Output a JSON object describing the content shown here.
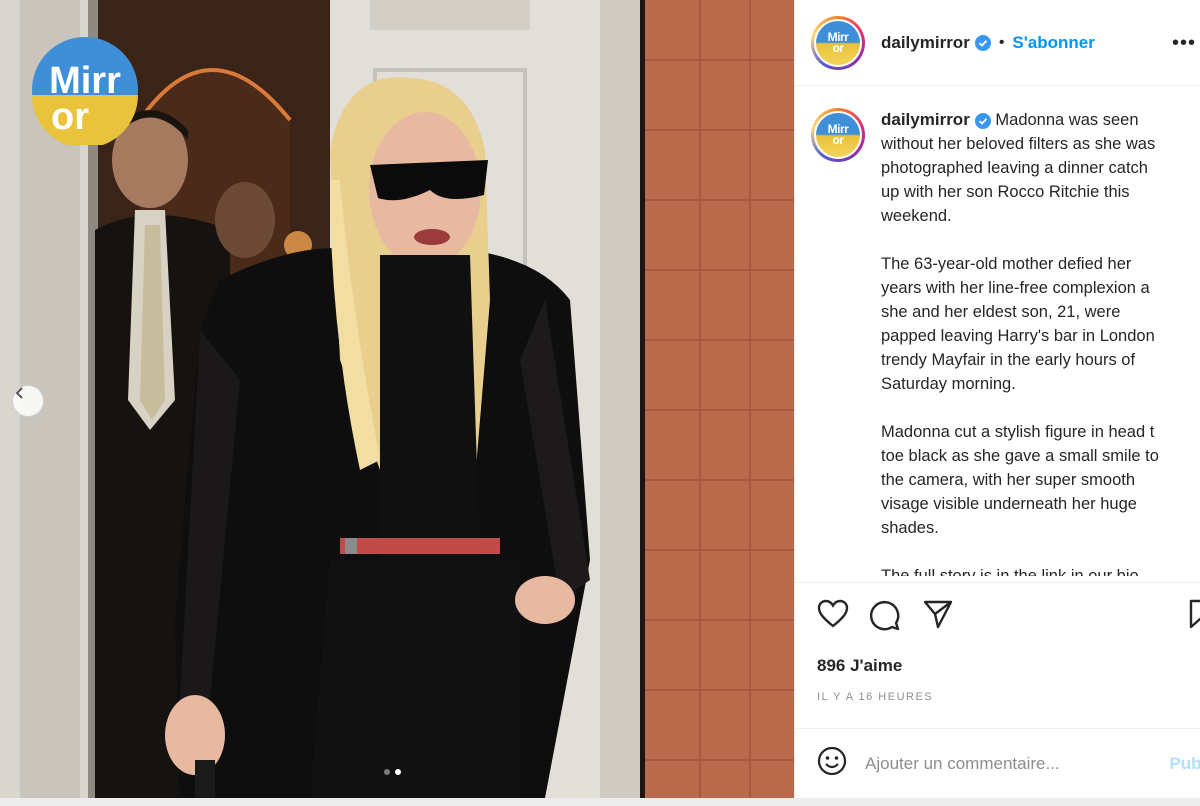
{
  "post": {
    "account": "dailymirror",
    "verified": true,
    "follow_label": "S'abonner",
    "separator": "•",
    "more_label": "•••",
    "caption_paragraphs": [
      [
        "Madonna was seen",
        "without her beloved filters as she was",
        "photographed leaving a dinner catch",
        "up with her son Rocco Ritchie this",
        "weekend."
      ],
      [
        "The 63-year-old mother defied her",
        "years with her line-free complexion a",
        "she and her eldest son, 21, were",
        "papped leaving Harry's bar in London",
        "trendy Mayfair in the early hours of",
        "Saturday morning."
      ],
      [
        "Madonna cut a stylish figure in head t",
        "toe black as she gave a small smile to",
        "the camera, with her super smooth",
        "visage visible underneath her huge",
        "shades."
      ]
    ],
    "caption_cut_line": "The full story is in the link in our bio",
    "likes": "896 J'aime",
    "timestamp": "IL Y A 16 HEURES",
    "comment_placeholder": "Ajouter un commentaire...",
    "publish_label": "Publi"
  },
  "photo": {
    "watermark_top": "Mirr",
    "watermark_bottom": "or",
    "carousel_count": 2,
    "carousel_active": 2
  },
  "icons": {
    "like": "heart-icon",
    "comment": "comment-icon",
    "share": "share-icon",
    "save": "bookmark-icon",
    "emoji": "emoji-icon",
    "verified": "verified-badge-icon",
    "prev": "chevron-left-icon"
  },
  "colors": {
    "accent": "#0095f6",
    "verified": "#3897f0",
    "mirror_blue": "#3f8fd8",
    "mirror_gold": "#e9c33b"
  }
}
